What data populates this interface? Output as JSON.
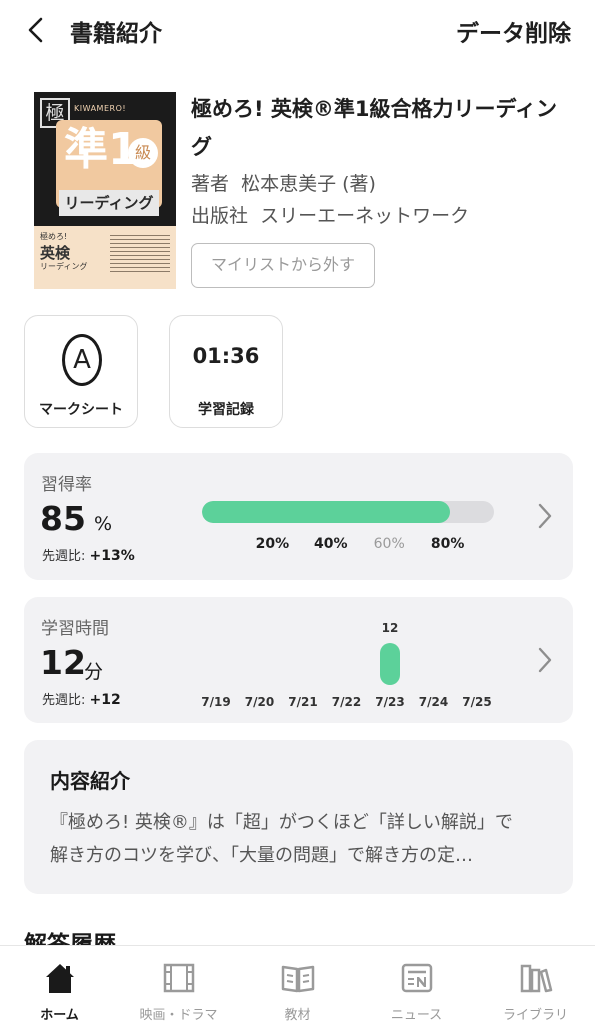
{
  "header": {
    "title": "書籍紹介",
    "delete_label": "データ削除"
  },
  "book": {
    "title": "極めろ! 英検®準1級合格力リーディング",
    "author_label": "著者",
    "author": "松本恵美子 (著)",
    "publisher_label": "出版社",
    "publisher": "スリーエーネットワーク",
    "mylist_button": "マイリストから外す",
    "cover": {
      "logo": "極",
      "brand": "KIWAMERO!",
      "main": "準1",
      "badge": "級",
      "sub": "リーディング",
      "small1": "極めろ!",
      "small2": "英検",
      "small3": "リーディング"
    }
  },
  "tiles": {
    "mark_sheet": {
      "icon_letter": "A",
      "label": "マークシート"
    },
    "study_record": {
      "value": "01:36",
      "label": "学習記録"
    }
  },
  "mastery": {
    "label": "習得率",
    "value": "85",
    "unit": "%",
    "diff_label": "先週比:",
    "diff_value": "+13%",
    "progress": 0.85,
    "ticks": [
      "20%",
      "40%",
      "60%",
      "80%"
    ],
    "tick_positions": [
      0.2,
      0.4,
      0.6,
      0.8
    ],
    "dim_tick_index": 2
  },
  "study_time": {
    "label": "学習時間",
    "value": "12",
    "unit": "分",
    "diff_label": "先週比:",
    "diff_value": "+12"
  },
  "chart_data": {
    "type": "bar",
    "categories": [
      "7/19",
      "7/20",
      "7/21",
      "7/22",
      "7/23",
      "7/24",
      "7/25"
    ],
    "values": [
      0,
      0,
      0,
      0,
      12,
      0,
      0
    ],
    "data_labels": [
      "",
      "",
      "",
      "",
      "12",
      "",
      ""
    ],
    "xlabel": "",
    "ylabel": ""
  },
  "description": {
    "title": "内容紹介",
    "line1": "『極めろ! 英検®』は「超」がつくほど「詳しい解説」で",
    "line2": "解き方のコツを学び、「大量の問題」で解き方の定…"
  },
  "history": {
    "heading": "解答履歴"
  },
  "tabbar": [
    {
      "label": "ホーム",
      "icon": "home-icon",
      "active": true
    },
    {
      "label": "映画・ドラマ",
      "icon": "film-icon",
      "active": false
    },
    {
      "label": "教材",
      "icon": "book-icon",
      "active": false
    },
    {
      "label": "ニュース",
      "icon": "news-icon",
      "active": false
    },
    {
      "label": "ライブラリ",
      "icon": "library-icon",
      "active": false
    }
  ],
  "colors": {
    "accent_green": "#5cd19a",
    "card_bg": "#f2f2f4"
  }
}
